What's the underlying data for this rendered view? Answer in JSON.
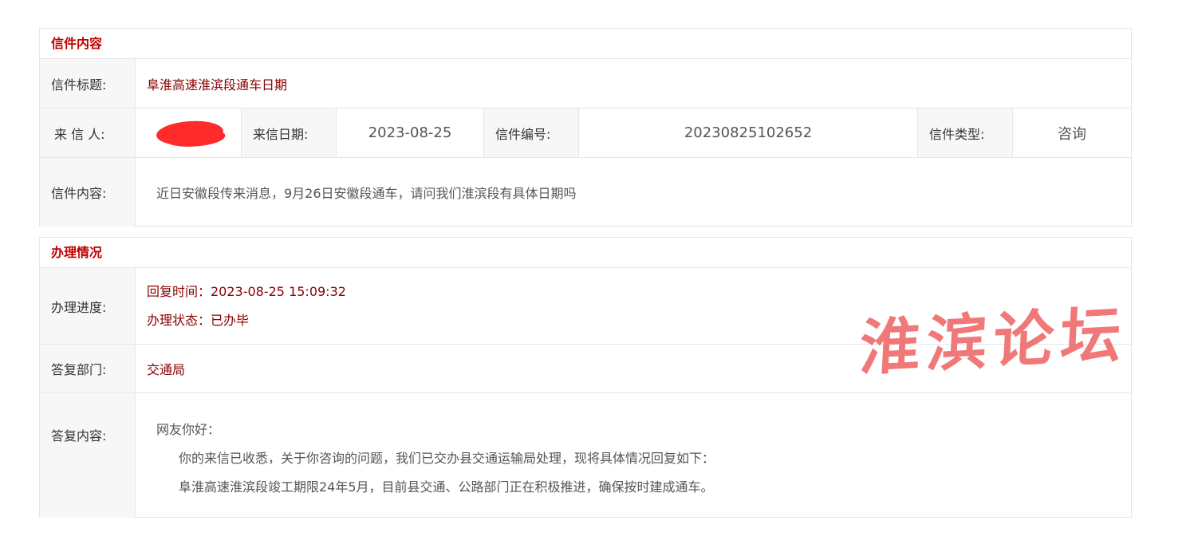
{
  "letter": {
    "header": "信件内容",
    "title_label": "信件标题:",
    "title_value": "阜淮高速淮滨段通车日期",
    "sender_label": "来 信 人:",
    "date_label": "来信日期:",
    "date_value": "2023-08-25",
    "number_label": "信件编号:",
    "number_value": "20230825102652",
    "type_label": "信件类型:",
    "type_value": "咨询",
    "content_label": "信件内容:",
    "content_value": "近日安徽段传来消息，9月26日安徽段通车，请问我们淮滨段有具体日期吗"
  },
  "handling": {
    "header": "办理情况",
    "progress_label": "办理进度:",
    "reply_time": "回复时间：2023-08-25 15:09:32",
    "status": "办理状态：已办毕",
    "dept_label": "答复部门:",
    "dept_value": "交通局",
    "reply_label": "答复内容:",
    "reply_greeting": "网友你好：",
    "reply_line1": "你的来信已收悉，关于你咨询的问题，我们已交办县交通运输局处理，现将具体情况回复如下：",
    "reply_line2": "阜淮高速淮滨段竣工期限24年5月，目前县交通、公路部门正在积极推进，确保按时建成通车。"
  },
  "watermark": "淮滨论坛",
  "colors": {
    "accent": "#c00000",
    "value_red": "#8b0000",
    "watermark": "#f07878"
  }
}
